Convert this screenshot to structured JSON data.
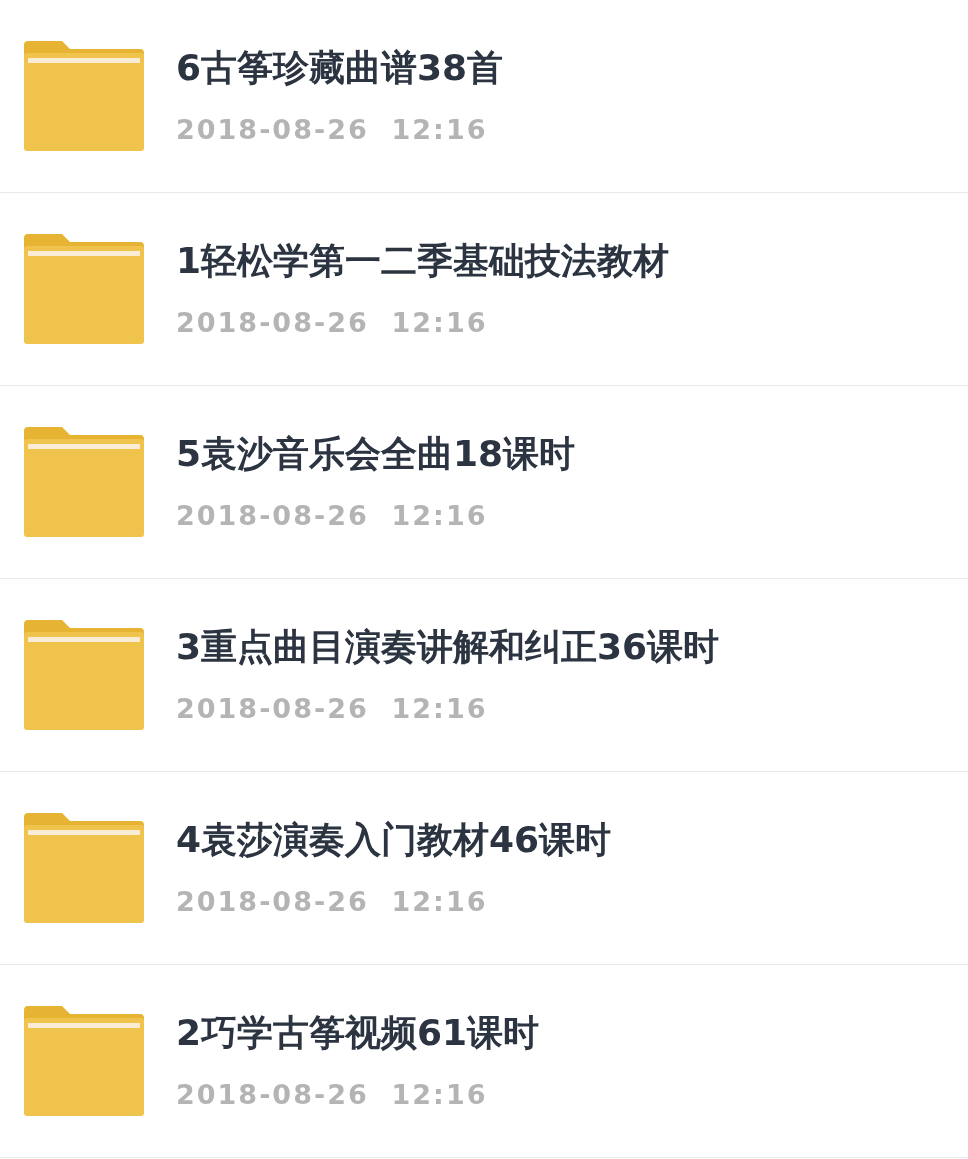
{
  "folders": [
    {
      "name": "6古筝珍藏曲谱38首",
      "date": "2018-08-26  12:16"
    },
    {
      "name": "1轻松学第一二季基础技法教材",
      "date": "2018-08-26  12:16"
    },
    {
      "name": "5袁沙音乐会全曲18课时",
      "date": "2018-08-26  12:16"
    },
    {
      "name": "3重点曲目演奏讲解和纠正36课时",
      "date": "2018-08-26  12:16"
    },
    {
      "name": "4袁莎演奏入门教材46课时",
      "date": "2018-08-26  12:16"
    },
    {
      "name": "2巧学古筝视频61课时",
      "date": "2018-08-26  12:16"
    }
  ]
}
